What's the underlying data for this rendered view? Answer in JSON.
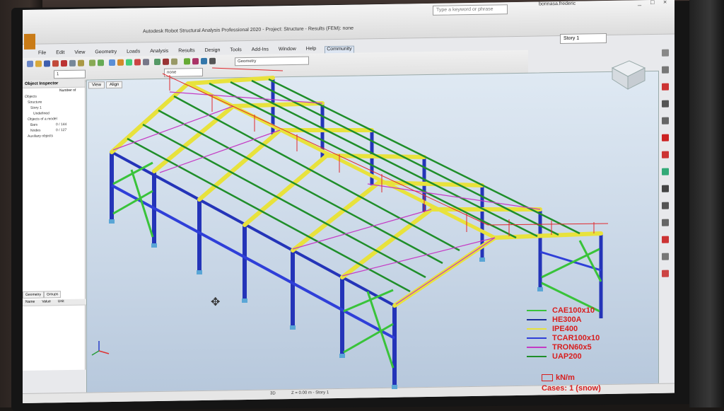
{
  "window": {
    "title": "Autodesk Robot Structural Analysis Professional 2020 - Project: Structure - Results (FEM): none",
    "search_placeholder": "Type a keyword or phrase",
    "user": "bonnasa.frederic",
    "controls": [
      "_",
      "□",
      "×"
    ]
  },
  "menu": [
    "File",
    "Edit",
    "View",
    "Geometry",
    "Loads",
    "Analysis",
    "Results",
    "Design",
    "Tools",
    "Add-Ins",
    "Window",
    "Help",
    "Community"
  ],
  "toolbar": {
    "geometry_combo": "Geometry",
    "selection_combo": "1",
    "view_combo": "none"
  },
  "story": {
    "selected": "Story 1"
  },
  "inspector": {
    "title": "Object Inspector",
    "col_number": "Number of",
    "tree": [
      "Objects",
      "Structure",
      "Story 1",
      "Undefined",
      "Objects of a model",
      "Bars",
      "Nodes",
      "Auxiliary objects"
    ],
    "counts": [
      "0 / 144",
      "0 / 127"
    ],
    "bottom_tabs": [
      "Geometry",
      "Groups"
    ],
    "prop_headers": [
      "Name",
      "Value",
      "Unit"
    ]
  },
  "viewport": {
    "tabs": [
      "View",
      "Align"
    ]
  },
  "status": {
    "view": "3D",
    "z_level": "Z = 0.00 m - Story 1"
  },
  "legend": {
    "items": [
      {
        "label": "CAE100x10",
        "color": "#39c33a"
      },
      {
        "label": "HE300A",
        "color": "#1d2f9c"
      },
      {
        "label": "IPE400",
        "color": "#e8e23c"
      },
      {
        "label": "TCAR100x10",
        "color": "#2f3fd8"
      },
      {
        "label": "TRON60x5",
        "color": "#c43bc4"
      },
      {
        "label": "UAP200",
        "color": "#1f8e2a"
      }
    ],
    "unit": "kN/m",
    "cases": "Cases: 1 (snow)"
  },
  "axes": {
    "x": "X",
    "y": "Y",
    "z": "Z"
  }
}
